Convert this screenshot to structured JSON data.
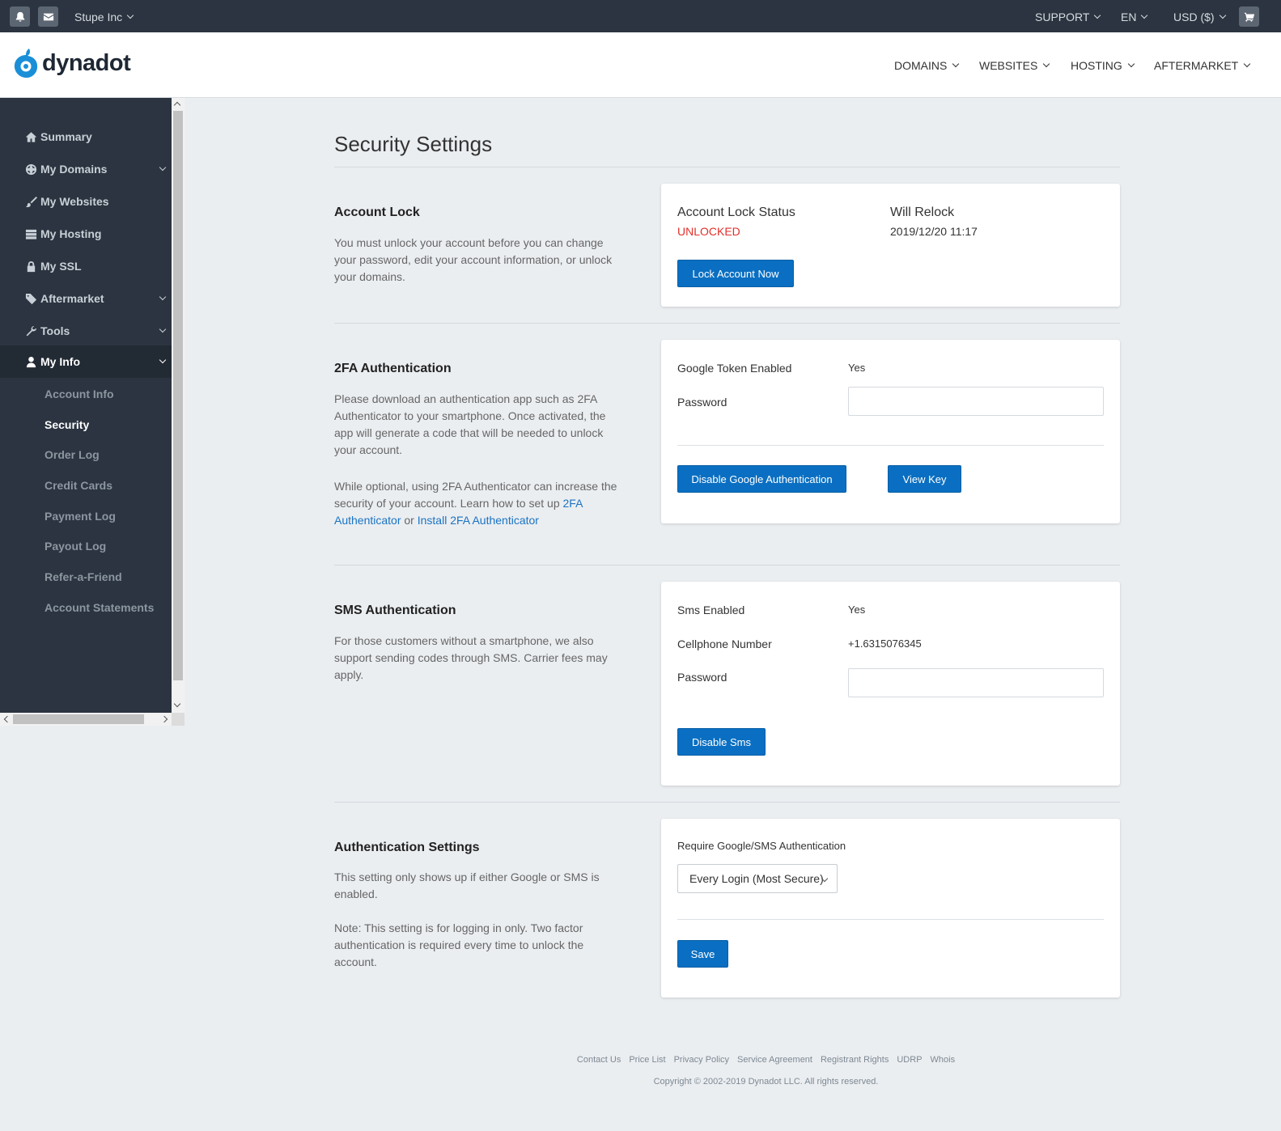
{
  "topbar": {
    "company": "Stupe Inc",
    "support": "SUPPORT",
    "language": "EN",
    "currency": "USD ($)"
  },
  "header": {
    "logo_text": "dynadot",
    "nav": [
      "DOMAINS",
      "WEBSITES",
      "HOSTING",
      "AFTERMARKET"
    ]
  },
  "sidebar": {
    "items": [
      {
        "label": "Summary",
        "icon": "home-icon"
      },
      {
        "label": "My Domains",
        "icon": "globe-icon"
      },
      {
        "label": "My Websites",
        "icon": "brush-icon"
      },
      {
        "label": "My Hosting",
        "icon": "server-icon"
      },
      {
        "label": "My SSL",
        "icon": "lock-icon"
      },
      {
        "label": "Aftermarket",
        "icon": "tags-icon"
      },
      {
        "label": "Tools",
        "icon": "wrench-icon"
      },
      {
        "label": "My Info",
        "icon": "user-icon"
      }
    ],
    "subitems": [
      "Account Info",
      "Security",
      "Order Log",
      "Credit Cards",
      "Payment Log",
      "Payout Log",
      "Refer-a-Friend",
      "Account Statements"
    ]
  },
  "page": {
    "title": "Security Settings"
  },
  "account_lock": {
    "title": "Account Lock",
    "desc": "You must unlock your account before you can change your password, edit your account information, or unlock your domains.",
    "status_label": "Account Lock Status",
    "status_value": "UNLOCKED",
    "relock_label": "Will Relock",
    "relock_value": "2019/12/20 11:17",
    "button": "Lock Account Now"
  },
  "twofa": {
    "title": "2FA Authentication",
    "desc1": "Please download an authentication app such as 2FA Authenticator to your smartphone. Once activated, the app will generate a code that will be needed to unlock your account.",
    "desc2_pre": "While optional, using 2FA Authenticator can increase the security of your account. Learn how to set up ",
    "desc2_link1": "2FA Authenticator",
    "desc2_mid": " or ",
    "desc2_link2": "Install 2FA Authenticator",
    "enabled_label": "Google Token Enabled",
    "enabled_value": "Yes",
    "password_label": "Password",
    "password_value": "",
    "disable_button": "Disable Google Authentication",
    "view_key_button": "View Key"
  },
  "sms": {
    "title": "SMS Authentication",
    "desc": "For those customers without a smartphone, we also support sending codes through SMS. Carrier fees may apply.",
    "enabled_label": "Sms Enabled",
    "enabled_value": "Yes",
    "phone_label": "Cellphone Number",
    "phone_value": "+1.6315076345",
    "password_label": "Password",
    "password_value": "",
    "disable_button": "Disable Sms"
  },
  "auth_settings": {
    "title": "Authentication Settings",
    "desc1": "This setting only shows up if either Google or SMS is enabled.",
    "desc2": "Note: This setting is for logging in only. Two factor authentication is required every time to unlock the account.",
    "require_label": "Require Google/SMS Authentication",
    "require_value": "Every Login (Most Secure)",
    "save_button": "Save"
  },
  "footer": {
    "links": [
      "Contact Us",
      "Price List",
      "Privacy Policy",
      "Service Agreement",
      "Registrant Rights",
      "UDRP",
      "Whois"
    ],
    "copyright": "Copyright © 2002-2019 Dynadot LLC. All rights reserved."
  },
  "colors": {
    "accent": "#0a6fc2",
    "unlocked": "#e0302b",
    "sidebar_bg": "#2b3440"
  }
}
